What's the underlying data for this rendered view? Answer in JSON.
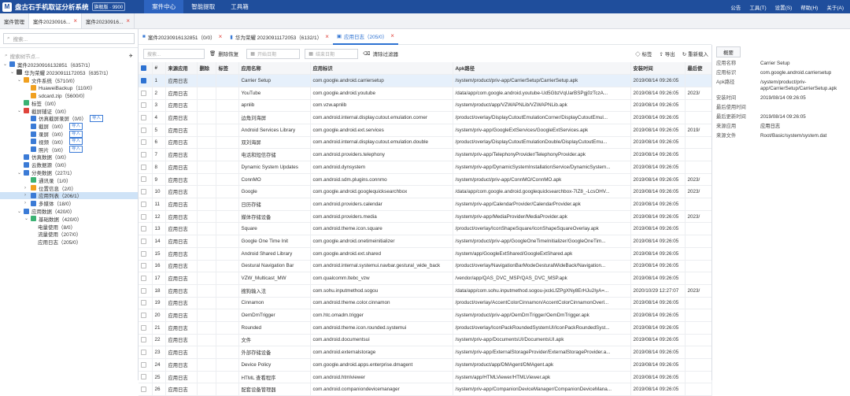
{
  "app": {
    "title": "盘古石手机取证分析系统",
    "version": "旗舰版 · 9900",
    "logo": "M"
  },
  "top_menu": [
    "案件中心",
    "智能提取",
    "工具箱"
  ],
  "top_right": [
    "公告",
    "工具(T)",
    "设置(S)",
    "帮助(H)",
    "关于(A)"
  ],
  "case_tabs": [
    {
      "label": "案件管理",
      "closable": false
    },
    {
      "label": "案件20230916...",
      "closable": true
    },
    {
      "label": "案件20230916...",
      "closable": true
    }
  ],
  "left": {
    "search_placeholder": "搜索...",
    "tree_filter_placeholder": "搜索树节点...",
    "tree": [
      {
        "indent": 0,
        "arrow": "⌄",
        "icon_color": "#3b7bd6",
        "label": "案件20230916132851（6357/1）",
        "count_red": false
      },
      {
        "indent": 1,
        "arrow": "⌄",
        "icon_color": "#555",
        "label": "华为荣耀 20230911172053（6357/1）"
      },
      {
        "indent": 2,
        "arrow": "⌄",
        "icon_color": "#f0a020",
        "label": "文件系统（5710/0）"
      },
      {
        "indent": 3,
        "arrow": "",
        "icon_color": "#f0a020",
        "label": "HuaweiBackup（110/0）"
      },
      {
        "indent": 3,
        "arrow": "",
        "icon_color": "#f0a020",
        "label": "sdcard.zip（5600/0）"
      },
      {
        "indent": 2,
        "arrow": "",
        "icon_color": "#3bb273",
        "label": "标签（0/0）"
      },
      {
        "indent": 2,
        "arrow": "⌄",
        "icon_color": "#e0443c",
        "label": "截屏辅证（0/0）"
      },
      {
        "indent": 3,
        "arrow": "",
        "icon_color": "#3b7bd6",
        "label": "仿真截屏录屏（0/0）",
        "import": "导入"
      },
      {
        "indent": 3,
        "arrow": "",
        "icon_color": "#3b7bd6",
        "label": "截屏（0/0）",
        "import": "导入"
      },
      {
        "indent": 3,
        "arrow": "",
        "icon_color": "#3b7bd6",
        "label": "录屏（0/0）",
        "import": "导入"
      },
      {
        "indent": 3,
        "arrow": "",
        "icon_color": "#3b7bd6",
        "label": "视频（0/0）",
        "import": "导入"
      },
      {
        "indent": 3,
        "arrow": "",
        "icon_color": "#3b7bd6",
        "label": "照片（0/0）",
        "import": "导入"
      },
      {
        "indent": 2,
        "arrow": "",
        "icon_color": "#3b7bd6",
        "label": "仿真数据（0/0）"
      },
      {
        "indent": 2,
        "arrow": "",
        "icon_color": "#3b7bd6",
        "label": "云数据源（0/0）"
      },
      {
        "indent": 2,
        "arrow": "⌄",
        "icon_color": "#3b7bd6",
        "label": "分类数据（227/1）"
      },
      {
        "indent": 3,
        "arrow": "",
        "icon_color": "#3bb273",
        "label": "通讯录（1/0）"
      },
      {
        "indent": 3,
        "arrow": "›",
        "icon_color": "#f0a020",
        "label": "位置信息（2/0）"
      },
      {
        "indent": 3,
        "arrow": "›",
        "icon_color": "#3b7bd6",
        "label": "应用列表（206/1）",
        "selected": true
      },
      {
        "indent": 3,
        "arrow": "›",
        "icon_color": "#3b7bd6",
        "label": "多媒体（18/0）"
      },
      {
        "indent": 2,
        "arrow": "⌄",
        "icon_color": "#3b7bd6",
        "label": "应用数据（420/0）"
      },
      {
        "indent": 3,
        "arrow": "⌄",
        "icon_color": "#3bb273",
        "label": "基础数据（420/0）"
      },
      {
        "indent": 4,
        "arrow": "",
        "icon_color": "",
        "label": "电量使用（8/0）"
      },
      {
        "indent": 4,
        "arrow": "",
        "icon_color": "",
        "label": "流量使用（207/0）"
      },
      {
        "indent": 4,
        "arrow": "",
        "icon_color": "",
        "label": "应用日志（205/0）"
      }
    ]
  },
  "main": {
    "tabs": [
      {
        "label": "案件20230916132851（0/0）",
        "active": false
      },
      {
        "label": "华为荣耀 20230911172053（6132/1）",
        "active": false
      },
      {
        "label": "应用日志（205/0）",
        "active": true
      }
    ],
    "toolbar": {
      "search_placeholder": "搜索...",
      "delete_restore": "删除恢复",
      "start_date": "开始日期",
      "end_date": "结束日期",
      "clear_filter": "清除过滤器",
      "tag": "标签",
      "export": "导出",
      "reload": "重新载入"
    },
    "columns": [
      "#",
      "来源应用",
      "删除",
      "标签",
      "应用名称",
      "应用标识",
      "Apk路径",
      "安装时间",
      "最后使"
    ],
    "rows": [
      [
        "1",
        "应用日志",
        "",
        "",
        "Carrier Setup",
        "com.google.android.carriersetup",
        "/system/product/priv-app/CarrierSetup/CarrierSetup.apk",
        "2019/08/14 09:26:05",
        ""
      ],
      [
        "2",
        "应用日志",
        "",
        "",
        "YouTube",
        "com.google.android.youtube",
        "/data/app/com.google.android.youtube-Ud5GbzVqUarBSPgj0zTczA...",
        "2019/08/14 09:26:05",
        "2023/"
      ],
      [
        "3",
        "应用日志",
        "",
        "",
        "apnlib",
        "com.vzw.apnlib",
        "/system/product/app/VZWAPNLib/VZWAPNLib.apk",
        "2019/08/14 09:26:05",
        ""
      ],
      [
        "4",
        "应用日志",
        "",
        "",
        "边角刘海屏",
        "com.android.internal.display.cutout.emulation.corner",
        "/product/overlay/DisplayCutoutEmulationCorner/DisplayCutoutEmul...",
        "2019/08/14 09:26:05",
        ""
      ],
      [
        "5",
        "应用日志",
        "",
        "",
        "Android Services Library",
        "com.google.android.ext.services",
        "/system/priv-app/GoogleExtServices/GoogleExtServices.apk",
        "2019/08/14 09:26:05",
        "2019/"
      ],
      [
        "6",
        "应用日志",
        "",
        "",
        "双刘海屏",
        "com.android.internal.display.cutout.emulation.double",
        "/product/overlay/DisplayCutoutEmulationDouble/DisplayCutoutEmu...",
        "2019/08/14 09:26:05",
        ""
      ],
      [
        "7",
        "应用日志",
        "",
        "",
        "电话和短信存储",
        "com.android.providers.telephony",
        "/system/priv-app/TelephonyProvider/TelephonyProvider.apk",
        "2019/08/14 09:26:05",
        ""
      ],
      [
        "8",
        "应用日志",
        "",
        "",
        "Dynamic System Updates",
        "com.android.dynsystem",
        "/system/priv-app/DynamicSystemInstallationService/DynamicSystem...",
        "2019/08/14 09:26:05",
        ""
      ],
      [
        "9",
        "应用日志",
        "",
        "",
        "ConnMO",
        "com.android.sdm.plugins.connmo",
        "/system/product/priv-app/ConnMO/ConnMO.apk",
        "2019/08/14 09:26:05",
        "2023/"
      ],
      [
        "10",
        "应用日志",
        "",
        "",
        "Google",
        "com.google.android.googlequicksearchbox",
        "/data/app/com.google.android.googlequicksearchbox-7IZ8_-LcsOHV...",
        "2019/08/14 09:26:05",
        "2023/"
      ],
      [
        "11",
        "应用日志",
        "",
        "",
        "日历存储",
        "com.android.providers.calendar",
        "/system/priv-app/CalendarProvider/CalendarProvider.apk",
        "2019/08/14 09:26:05",
        ""
      ],
      [
        "12",
        "应用日志",
        "",
        "",
        "媒体存储设备",
        "com.android.providers.media",
        "/system/priv-app/MediaProvider/MediaProvider.apk",
        "2019/08/14 09:26:05",
        "2023/"
      ],
      [
        "13",
        "应用日志",
        "",
        "",
        "Square",
        "com.android.theme.icon.square",
        "/product/overlay/IconShapeSquare/IconShapeSquareOverlay.apk",
        "2019/08/14 09:26:05",
        ""
      ],
      [
        "14",
        "应用日志",
        "",
        "",
        "Google One Time Init",
        "com.google.android.onetimeinitializer",
        "/system/product/priv-app/GoogleOneTimeInitializer/GoogleOneTim...",
        "2019/08/14 09:26:05",
        ""
      ],
      [
        "15",
        "应用日志",
        "",
        "",
        "Android Shared Library",
        "com.google.android.ext.shared",
        "/system/app/GoogleExtShared/GoogleExtShared.apk",
        "2019/08/14 09:26:05",
        ""
      ],
      [
        "16",
        "应用日志",
        "",
        "",
        "Gestural Navigation Bar",
        "com.android.internal.systemui.navbar.gestural_wide_back",
        "/product/overlay/NavigationBarModeGesturalWideBack/Navigation...",
        "2019/08/14 09:26:05",
        ""
      ],
      [
        "17",
        "应用日志",
        "",
        "",
        "VZW_Multicast_MW",
        "com.qualcomm.ltebc_vzw",
        "/vendor/app/QAS_DVC_MSP/QAS_DVC_MSP.apk",
        "2019/08/14 09:26:05",
        ""
      ],
      [
        "18",
        "应用日志",
        "",
        "",
        "搜狗输入法",
        "com.sohu.inputmethod.sogou",
        "/data/app/com.sohu.inputmethod.sogou-jxckLfZPgXNy8ErHJu2IyA=...",
        "2020/10/29 12:27:07",
        "2023/"
      ],
      [
        "19",
        "应用日志",
        "",
        "",
        "Cinnamon",
        "com.android.theme.color.cinnamon",
        "/product/overlay/AccentColorCinnamon/AccentColorCinnamonOverl...",
        "2019/08/14 09:26:05",
        ""
      ],
      [
        "20",
        "应用日志",
        "",
        "",
        "OemDmTrigger",
        "com.htc.omadm.trigger",
        "/system/product/priv-app/OemDmTrigger/OemDmTrigger.apk",
        "2019/08/14 09:26:05",
        ""
      ],
      [
        "21",
        "应用日志",
        "",
        "",
        "Rounded",
        "com.android.theme.icon.rounded.systemui",
        "/product/overlay/IconPackRoundedSystemUI/IconPackRoundedSyst...",
        "2019/08/14 09:26:05",
        ""
      ],
      [
        "22",
        "应用日志",
        "",
        "",
        "文件",
        "com.android.documentsui",
        "/system/priv-app/DocumentsUI/DocumentsUI.apk",
        "2019/08/14 09:26:05",
        ""
      ],
      [
        "23",
        "应用日志",
        "",
        "",
        "外部存储设备",
        "com.android.externalstorage",
        "/system/priv-app/ExternalStorageProvider/ExternalStorageProvider.a...",
        "2019/08/14 09:26:05",
        ""
      ],
      [
        "24",
        "应用日志",
        "",
        "",
        "Device Policy",
        "com.google.android.apps.enterprise.dmagent",
        "/system/product/app/DMAgent/DMAgent.apk",
        "2019/08/14 09:26:05",
        ""
      ],
      [
        "25",
        "应用日志",
        "",
        "",
        "HTML 查看程序",
        "com.android.htmlviewer",
        "/system/app/HTMLViewer/HTMLViewer.apk",
        "2019/08/14 09:26:05",
        ""
      ],
      [
        "26",
        "应用日志",
        "",
        "",
        "配套设备管理器",
        "com.android.companiondevicemanager",
        "/system/priv-app/CompanionDeviceManager/CompanionDeviceMana...",
        "2019/08/14 09:26:05",
        ""
      ]
    ]
  },
  "details": {
    "tab": "概要",
    "props": [
      {
        "k": "应用名称",
        "v": "Carrier Setup"
      },
      {
        "k": "应用标识",
        "v": "com.google.android.carriersetup"
      },
      {
        "k": "Apk路径",
        "v": "/system/product/priv-app/CarrierSetup/CarrierSetup.apk"
      },
      {
        "k": "安装时间",
        "v": "2019/08/14 09:26:05"
      },
      {
        "k": "最后使用时间",
        "v": ""
      },
      {
        "k": "最后更新时间",
        "v": "2019/08/14 09:26:05"
      },
      {
        "k": "来源应用",
        "v": "应用日志"
      },
      {
        "k": "来源文件",
        "v": "Root/Basic/system/system.dat"
      }
    ]
  }
}
